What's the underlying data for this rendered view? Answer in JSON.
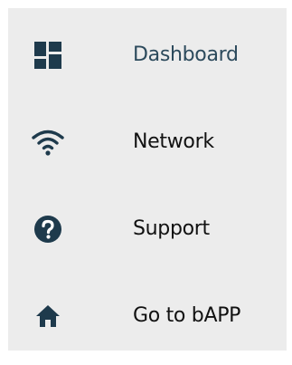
{
  "menu": {
    "items": [
      {
        "label": "Dashboard",
        "icon": "dashboard-icon",
        "active": true
      },
      {
        "label": "Network",
        "icon": "wifi-icon",
        "active": false
      },
      {
        "label": "Support",
        "icon": "help-circle-icon",
        "active": false
      },
      {
        "label": "Go to bAPP",
        "icon": "home-icon",
        "active": false
      }
    ]
  },
  "colors": {
    "icon": "#1e3a4c",
    "active_label": "#2c4a5c",
    "label": "#111111",
    "background": "#ececec"
  }
}
